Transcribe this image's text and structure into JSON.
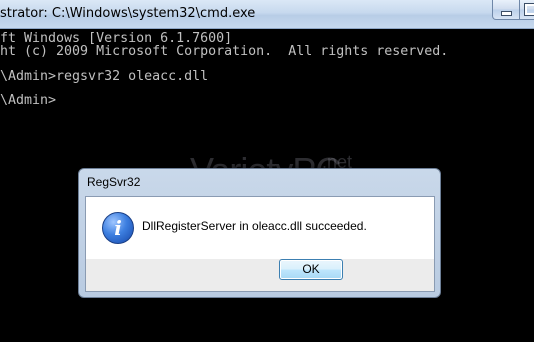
{
  "cmd_window": {
    "title": "strator: C:\\Windows\\system32\\cmd.exe",
    "lines": [
      "ft Windows [Version 6.1.7600]",
      "ht (c) 2009 Microsoft Corporation.  All rights reserved.",
      "",
      "\\Admin>regsvr32 oleacc.dll",
      "",
      "\\Admin>"
    ]
  },
  "watermark": {
    "text": "VarietyPC",
    "suffix": ".net"
  },
  "dialog": {
    "title": "RegSvr32",
    "icon": "info-icon",
    "message": "DllRegisterServer in oleacc.dll succeeded.",
    "ok_label": "OK"
  }
}
